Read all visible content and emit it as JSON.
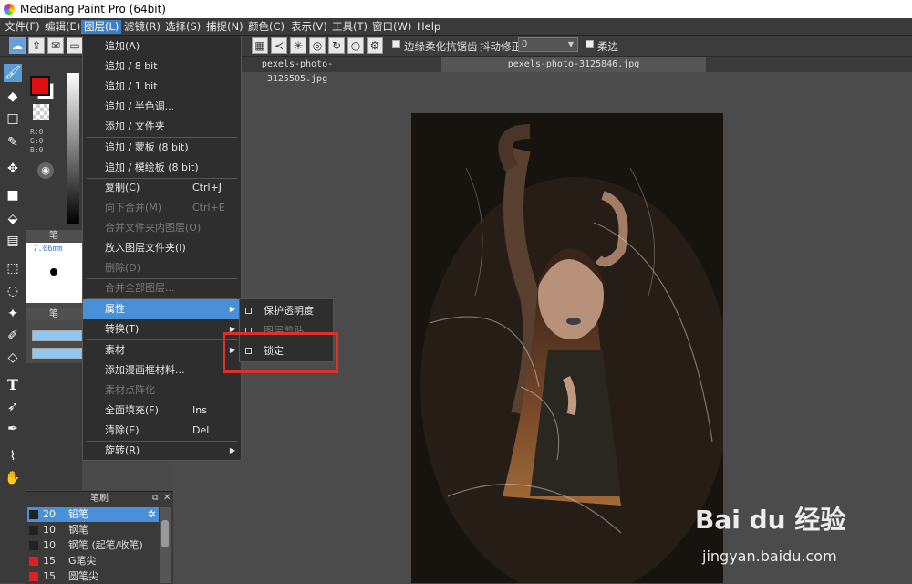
{
  "window": {
    "title": "MediBang Paint Pro (64bit)"
  },
  "menubar": [
    {
      "label": "文件(F)"
    },
    {
      "label": "编辑(E)"
    },
    {
      "label": "图层(L)"
    },
    {
      "label": "滤镜(R)"
    },
    {
      "label": "选择(S)"
    },
    {
      "label": "捕捉(N)"
    },
    {
      "label": "颜色(C)"
    },
    {
      "label": "表示(V)"
    },
    {
      "label": "工具(T)"
    },
    {
      "label": "窗口(W)"
    },
    {
      "label": "Help"
    }
  ],
  "toolbar": {
    "antialias_label": "边缘柔化抗锯齿",
    "stabilizer_label": "抖动修正",
    "stabilizer_value": "0",
    "soft_label": "柔边"
  },
  "color": {
    "fg": "#e01010",
    "bg": "#ffffff",
    "r": "R:0",
    "g": "G:0",
    "b": "B:0"
  },
  "brush_size": {
    "header": "笔",
    "value": "7.06mm"
  },
  "brush_opacity": {
    "header": "笔"
  },
  "tabs": [
    {
      "label": "pexels-photo-3125505.jpg"
    },
    {
      "label": "pexels-photo-3125846.jpg"
    }
  ],
  "layer_menu": {
    "items": [
      {
        "label": "追加(A)"
      },
      {
        "label": "追加 / 8 bit"
      },
      {
        "label": "追加 / 1 bit"
      },
      {
        "label": "追加 / 半色调..."
      },
      {
        "label": "添加 / 文件夹"
      },
      {
        "label": "追加 / 蒙板 (8 bit)"
      },
      {
        "label": "追加 / 模绘板 (8 bit)"
      },
      {
        "label": "复制(C)",
        "shortcut": "Ctrl+J"
      },
      {
        "label": "向下合并(M)",
        "shortcut": "Ctrl+E"
      },
      {
        "label": "合并文件夹内图层(O)"
      },
      {
        "label": "放入图层文件夹(I)"
      },
      {
        "label": "删除(D)"
      },
      {
        "label": "合并全部图层..."
      },
      {
        "label": "属性"
      },
      {
        "label": "转换(T)"
      },
      {
        "label": "素材"
      },
      {
        "label": "添加漫画框材料..."
      },
      {
        "label": "素材点阵化"
      },
      {
        "label": "全面填充(F)",
        "shortcut": "Ins"
      },
      {
        "label": "清除(E)",
        "shortcut": "Del"
      },
      {
        "label": "旋转(R)"
      }
    ]
  },
  "attributes_submenu": [
    {
      "label": "保护透明度"
    },
    {
      "label": "图层剪贴"
    },
    {
      "label": "锁定"
    }
  ],
  "brush_panel": {
    "header": "笔刷",
    "items": [
      {
        "size": "20",
        "name": "铅笔"
      },
      {
        "size": "10",
        "name": "钢笔"
      },
      {
        "size": "10",
        "name": "钢笔 (起笔/收笔)"
      },
      {
        "size": "15",
        "name": "G笔尖"
      },
      {
        "size": "15",
        "name": "圆笔尖"
      }
    ]
  },
  "watermark": {
    "brand": "Bai du 经验",
    "url": "jingyan.baidu.com"
  }
}
